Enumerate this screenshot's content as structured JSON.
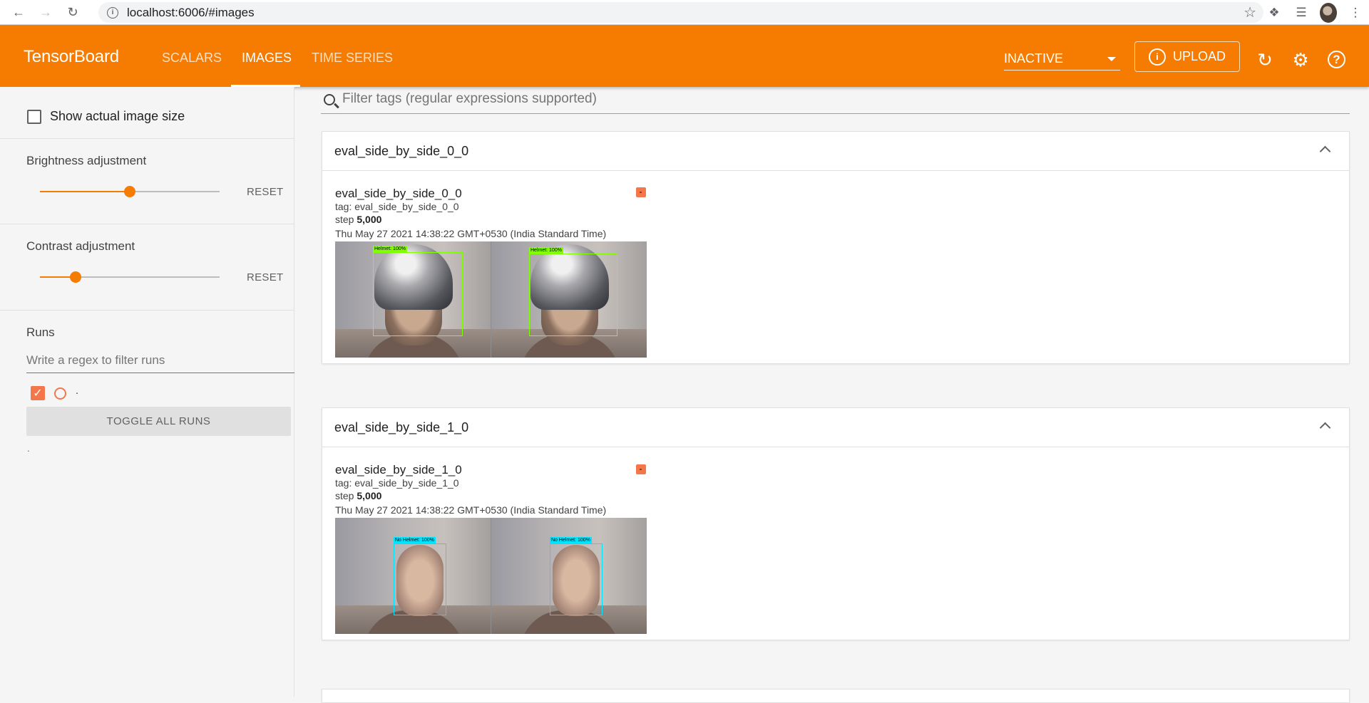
{
  "browser": {
    "url": "localhost:6006/#images"
  },
  "header": {
    "logo": "TensorBoard",
    "tabs": [
      {
        "label": "SCALARS"
      },
      {
        "label": "IMAGES"
      },
      {
        "label": "TIME SERIES"
      }
    ],
    "active_tab": "IMAGES",
    "run_select": "INACTIVE",
    "upload_label": "UPLOAD",
    "accent_color": "#f57c00"
  },
  "sidebar": {
    "show_actual_size_label": "Show actual image size",
    "show_actual_size_checked": false,
    "brightness": {
      "title": "Brightness adjustment",
      "reset": "RESET",
      "value": 0.5
    },
    "contrast": {
      "title": "Contrast adjustment",
      "reset": "RESET",
      "value": 0.2
    },
    "runs": {
      "title": "Runs",
      "filter_placeholder": "Write a regex to filter runs",
      "items": [
        {
          "name": ".",
          "checked": true,
          "color": "#f4774b"
        }
      ],
      "toggle_label": "TOGGLE ALL RUNS",
      "footer_text": "."
    }
  },
  "main": {
    "filter_placeholder": "Filter tags (regular expressions supported)",
    "cards": [
      {
        "title": "eval_side_by_side_0_0",
        "image_name": "eval_side_by_side_0_0",
        "tag": "tag: eval_side_by_side_0_0",
        "step_label": "step",
        "step_value": "5,000",
        "datetime": "Thu May 27 2021 14:38:22 GMT+0530 (India Standard Time)",
        "detections": [
          {
            "label": "Helmet: 100%",
            "color": "#7fff00"
          },
          {
            "label": "Helmet: 100%",
            "color": "#7fff00"
          }
        ]
      },
      {
        "title": "eval_side_by_side_1_0",
        "image_name": "eval_side_by_side_1_0",
        "tag": "tag: eval_side_by_side_1_0",
        "step_label": "step",
        "step_value": "5,000",
        "datetime": "Thu May 27 2021 14:38:22 GMT+0530 (India Standard Time)",
        "detections": [
          {
            "label": "No Helmet: 100%",
            "color": "#00e5ff"
          },
          {
            "label": "No Helmet: 100%",
            "color": "#00e5ff"
          }
        ]
      }
    ]
  }
}
